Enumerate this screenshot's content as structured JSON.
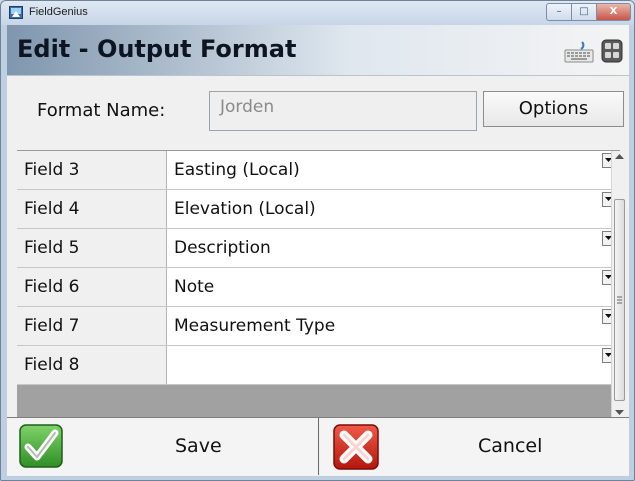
{
  "window": {
    "title": "FieldGenius",
    "minimize": "–",
    "maximize": "□",
    "close": "X"
  },
  "header": {
    "title": "Edit - Output Format"
  },
  "format": {
    "label": "Format Name:",
    "value": "Jorden"
  },
  "options_label": "Options",
  "rows": [
    {
      "field": "Field 3",
      "value": "Easting (Local)"
    },
    {
      "field": "Field 4",
      "value": "Elevation (Local)"
    },
    {
      "field": "Field 5",
      "value": "Description"
    },
    {
      "field": "Field 6",
      "value": "Note"
    },
    {
      "field": "Field 7",
      "value": "Measurement Type"
    },
    {
      "field": "Field 8",
      "value": ""
    }
  ],
  "footer": {
    "save_label": "Save",
    "cancel_label": "Cancel"
  }
}
